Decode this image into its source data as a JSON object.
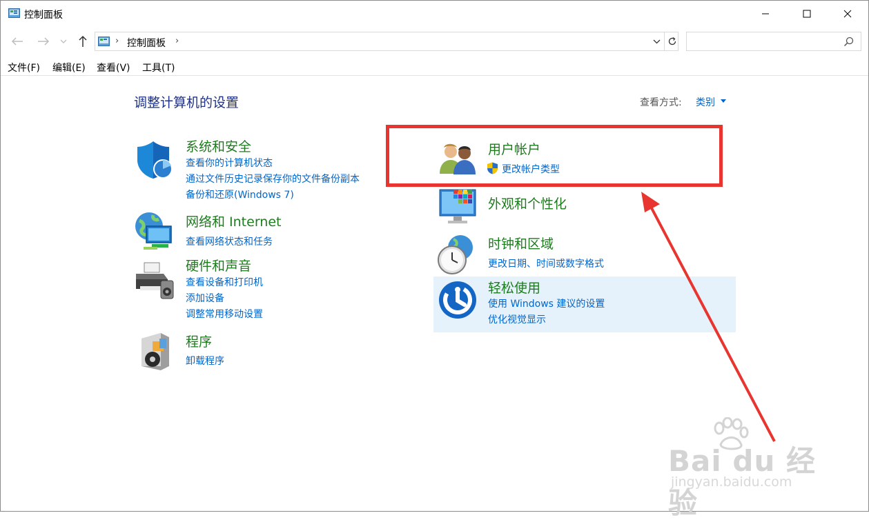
{
  "window": {
    "title": "控制面板",
    "controls": {
      "minimize": "minimize-icon",
      "maximize": "maximize-icon",
      "close": "close-icon"
    }
  },
  "address_bar": {
    "crumb": "控制面板",
    "separator": "›",
    "search_placeholder": ""
  },
  "menu": [
    "文件(F)",
    "编辑(E)",
    "查看(V)",
    "工具(T)"
  ],
  "main": {
    "title": "调整计算机的设置",
    "view_by_label": "查看方式:",
    "view_by_value": "类别"
  },
  "categories": {
    "system_security": {
      "title": "系统和安全",
      "links": [
        "查看你的计算机状态",
        "通过文件历史记录保存你的文件备份副本",
        "备份和还原(Windows 7)"
      ]
    },
    "network": {
      "title": "网络和 Internet",
      "links": [
        "查看网络状态和任务"
      ]
    },
    "hardware": {
      "title": "硬件和声音",
      "links": [
        "查看设备和打印机",
        "添加设备",
        "调整常用移动设置"
      ]
    },
    "programs": {
      "title": "程序",
      "links": [
        "卸载程序"
      ]
    },
    "user_accounts": {
      "title": "用户帐户",
      "links": [
        "更改帐户类型"
      ]
    },
    "appearance": {
      "title": "外观和个性化",
      "links": []
    },
    "clock_region": {
      "title": "时钟和区域",
      "links": [
        "更改日期、时间或数字格式"
      ]
    },
    "ease_of_access": {
      "title": "轻松使用",
      "links": [
        "使用 Windows 建议的设置",
        "优化视觉显示"
      ]
    }
  },
  "annotation": {
    "color": "#e8352f"
  },
  "watermark": {
    "logo": "Bai du 经验",
    "url": "jingyan.baidu.com"
  },
  "colors": {
    "title_blue": "#1e3287",
    "category_green": "#1e7b1e",
    "link_blue": "#0066cc",
    "hover": "#e5f1fb"
  }
}
